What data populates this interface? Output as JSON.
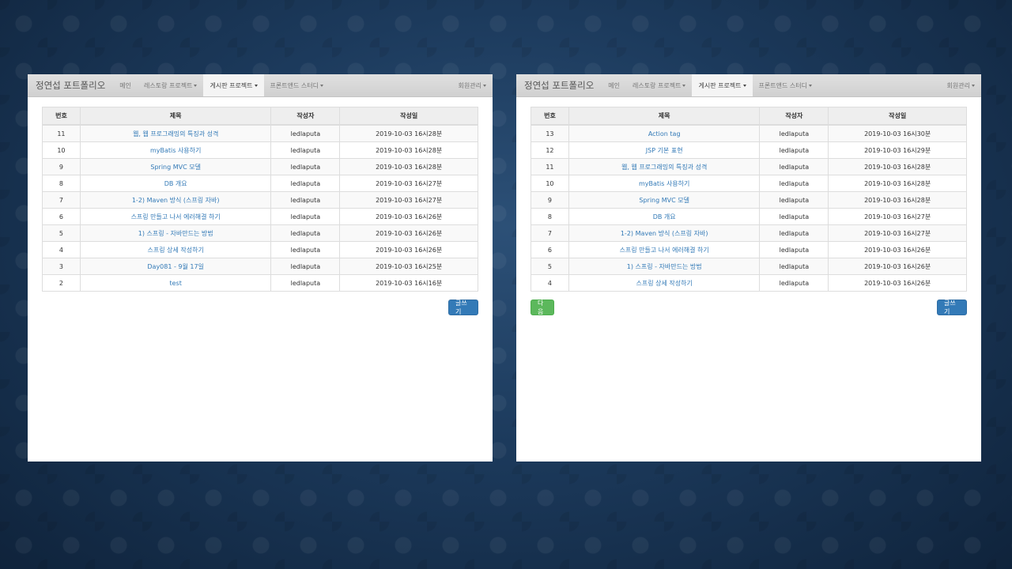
{
  "windows": [
    {
      "navbar": {
        "brand": "정연섭 포트폴리오",
        "items": [
          "메인",
          "레스토랑 프로젝트",
          "게시판 프로젝트",
          "프론트앤드 스터디"
        ],
        "right": "회원관리"
      },
      "table": {
        "headers": [
          "번호",
          "제목",
          "작성자",
          "작성일"
        ],
        "rows": [
          [
            "11",
            "웹, 웹 프로그래밍의 특징과 성격",
            "ledlaputa",
            "2019-10-03 16시28분"
          ],
          [
            "10",
            "myBatis 사용하기",
            "ledlaputa",
            "2019-10-03 16시28분"
          ],
          [
            "9",
            "Spring MVC 모델",
            "ledlaputa",
            "2019-10-03 16시28분"
          ],
          [
            "8",
            "DB 개요",
            "ledlaputa",
            "2019-10-03 16시27분"
          ],
          [
            "7",
            "1-2) Maven 방식 (스프링 자바)",
            "ledlaputa",
            "2019-10-03 16시27분"
          ],
          [
            "6",
            "스프링 만들고 나서 에러해결 하기",
            "ledlaputa",
            "2019-10-03 16시26분"
          ],
          [
            "5",
            "1) 스프링 - 자바만드는 방법",
            "ledlaputa",
            "2019-10-03 16시26분"
          ],
          [
            "4",
            "스프링 상세 작성하기",
            "ledlaputa",
            "2019-10-03 16시26분"
          ],
          [
            "3",
            "Day081 - 9월 17일",
            "ledlaputa",
            "2019-10-03 16시25분"
          ],
          [
            "2",
            "test",
            "ledlaputa",
            "2019-10-03 16시16분"
          ]
        ]
      },
      "write_button": "글쓰기"
    },
    {
      "navbar": {
        "brand": "정연섭 포트폴리오",
        "items": [
          "메인",
          "레스토랑 프로젝트",
          "게시판 프로젝트",
          "프론트앤드 스터디"
        ],
        "right": "회원관리"
      },
      "table": {
        "headers": [
          "번호",
          "제목",
          "작성자",
          "작성일"
        ],
        "rows": [
          [
            "13",
            "Action tag",
            "ledlaputa",
            "2019-10-03 16시30분"
          ],
          [
            "12",
            "JSP 기본 표현",
            "ledlaputa",
            "2019-10-03 16시29분"
          ],
          [
            "11",
            "웹, 웹 프로그래밍의 특징과 성격",
            "ledlaputa",
            "2019-10-03 16시28분"
          ],
          [
            "10",
            "myBatis 사용하기",
            "ledlaputa",
            "2019-10-03 16시28분"
          ],
          [
            "9",
            "Spring MVC 모델",
            "ledlaputa",
            "2019-10-03 16시28분"
          ],
          [
            "8",
            "DB 개요",
            "ledlaputa",
            "2019-10-03 16시27분"
          ],
          [
            "7",
            "1-2) Maven 방식 (스프링 자바)",
            "ledlaputa",
            "2019-10-03 16시27분"
          ],
          [
            "6",
            "스프링 만들고 나서 에러해결 하기",
            "ledlaputa",
            "2019-10-03 16시26분"
          ],
          [
            "5",
            "1) 스프링 - 자바만드는 방법",
            "ledlaputa",
            "2019-10-03 16시26분"
          ],
          [
            "4",
            "스프링 상세 작성하기",
            "ledlaputa",
            "2019-10-03 16시26분"
          ]
        ]
      },
      "next_button": "다음",
      "write_button": "글쓰기"
    }
  ],
  "colors": {
    "link": "#337ab7",
    "primary": "#337ab7",
    "success": "#5cb85c",
    "background": "#1c3a5c"
  }
}
